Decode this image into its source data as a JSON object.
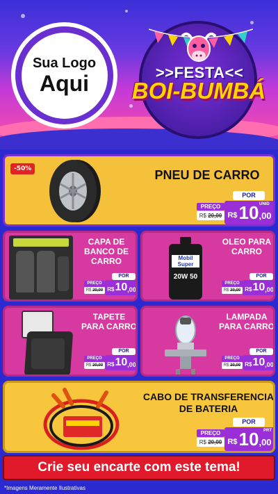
{
  "header": {
    "logo_line1": "Sua Logo",
    "logo_line2": "Aqui",
    "festa_title": ">>FESTA<<",
    "festa_subtitle": "BOI-BUMBÁ"
  },
  "products": [
    {
      "title": "PNEU DE CARRO",
      "discount": "-50%",
      "por_label": "POR",
      "preco_label": "PREÇO",
      "old_prefix": "R$",
      "old_price": "20,00",
      "new_prefix": "R$",
      "new_int": "10",
      "new_dec": ",00",
      "unit": "UNID",
      "image_icon": "tire-icon"
    },
    {
      "title": "CAPA DE BANCO DE CARRO",
      "por_label": "POR",
      "preco_label": "PREÇO",
      "old_prefix": "R$",
      "old_price": "20,00",
      "new_prefix": "R$",
      "new_int": "10",
      "new_dec": ",00",
      "image_icon": "seat-cover-icon"
    },
    {
      "title": "OLEO PARA CARRO",
      "por_label": "POR",
      "preco_label": "PREÇO",
      "old_prefix": "R$",
      "old_price": "20,00",
      "new_prefix": "R$",
      "new_int": "10",
      "new_dec": ",00",
      "image_icon": "motor-oil-icon",
      "brand_text": "Mobil Super",
      "grade_text": "20W 50"
    },
    {
      "title": "TAPETE PARA CARRO",
      "por_label": "POR",
      "preco_label": "PREÇO",
      "old_prefix": "R$",
      "old_price": "20,00",
      "new_prefix": "R$",
      "new_int": "10",
      "new_dec": ",00",
      "image_icon": "car-mat-icon"
    },
    {
      "title": "LAMPADA PARA CARRO",
      "por_label": "POR",
      "preco_label": "PREÇO",
      "old_prefix": "R$",
      "old_price": "20,00",
      "new_prefix": "R$",
      "new_int": "10",
      "new_dec": ",00",
      "image_icon": "headlight-bulb-icon"
    },
    {
      "title": "CABO DE TRANSFERENCIA DE BATERIA",
      "por_label": "POR",
      "preco_label": "PREÇO",
      "old_prefix": "R$",
      "old_price": "20,00",
      "new_prefix": "R$",
      "new_int": "10",
      "new_dec": ",00",
      "unit": "PRT",
      "image_icon": "jumper-cable-icon"
    }
  ],
  "footer": {
    "cta": "Crie seu encarte com este tema!",
    "disclaimer": "*Imagens Meramente Ilustrativas"
  },
  "colors": {
    "accent_purple": "#9a2fd8",
    "card_yellow": "#f6c13a",
    "card_pink": "#d63aa0",
    "cta_red": "#e01a2a",
    "brand_yellow": "#ffd400"
  }
}
